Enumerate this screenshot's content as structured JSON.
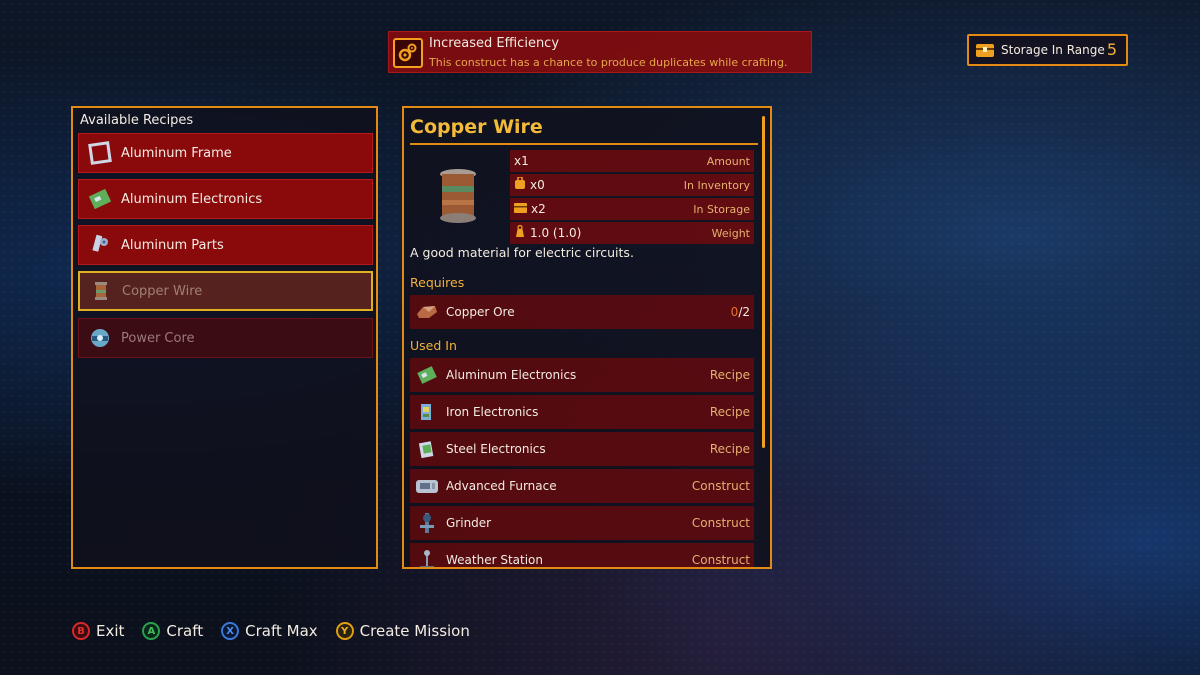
{
  "effect_banner": {
    "title": "Increased Efficiency",
    "description": "This construct has a chance to produce duplicates while crafting.",
    "icon": "gears-icon"
  },
  "storage": {
    "label": "Storage In Range",
    "count": "5",
    "icon": "chest-icon"
  },
  "recipes": {
    "title": "Available Recipes",
    "items": [
      {
        "label": "Aluminum Frame",
        "icon": "frame-icon",
        "state": "available"
      },
      {
        "label": "Aluminum Electronics",
        "icon": "circuit-board-icon",
        "state": "available"
      },
      {
        "label": "Aluminum Parts",
        "icon": "parts-icon",
        "state": "available"
      },
      {
        "label": "Copper Wire",
        "icon": "wire-spool-icon",
        "state": "selected"
      },
      {
        "label": "Power Core",
        "icon": "power-core-icon",
        "state": "unavailable"
      }
    ]
  },
  "detail": {
    "title": "Copper Wire",
    "icon": "wire-spool-icon",
    "stats": [
      {
        "value": "x1",
        "label": "Amount",
        "icon": ""
      },
      {
        "value": "x0",
        "label": "In Inventory",
        "icon": "backpack-icon"
      },
      {
        "value": "x2",
        "label": "In Storage",
        "icon": "chest-icon"
      },
      {
        "value": "1.0 (1.0)",
        "label": "Weight",
        "icon": "weight-icon"
      }
    ],
    "description": "A good material for electric circuits.",
    "requires_heading": "Requires",
    "requires": [
      {
        "name": "Copper Ore",
        "have": "0",
        "need": "/2",
        "icon": "copper-ore-icon"
      }
    ],
    "used_in_heading": "Used In",
    "used_in": [
      {
        "name": "Aluminum Electronics",
        "type": "Recipe",
        "icon": "circuit-board-icon"
      },
      {
        "name": "Iron Electronics",
        "type": "Recipe",
        "icon": "circuit-board-icon"
      },
      {
        "name": "Steel Electronics",
        "type": "Recipe",
        "icon": "circuit-board-icon"
      },
      {
        "name": "Advanced Furnace",
        "type": "Construct",
        "icon": "furnace-icon"
      },
      {
        "name": "Grinder",
        "type": "Construct",
        "icon": "grinder-icon"
      },
      {
        "name": "Weather Station",
        "type": "Construct",
        "icon": "weather-station-icon"
      }
    ]
  },
  "controls": [
    {
      "button": "B",
      "label": "Exit"
    },
    {
      "button": "A",
      "label": "Craft"
    },
    {
      "button": "X",
      "label": "Craft Max"
    },
    {
      "button": "Y",
      "label": "Create Mission"
    }
  ],
  "colors": {
    "accent": "#e38a12",
    "row_red": "#8a0a0c",
    "title_gold": "#f4ba3a"
  }
}
